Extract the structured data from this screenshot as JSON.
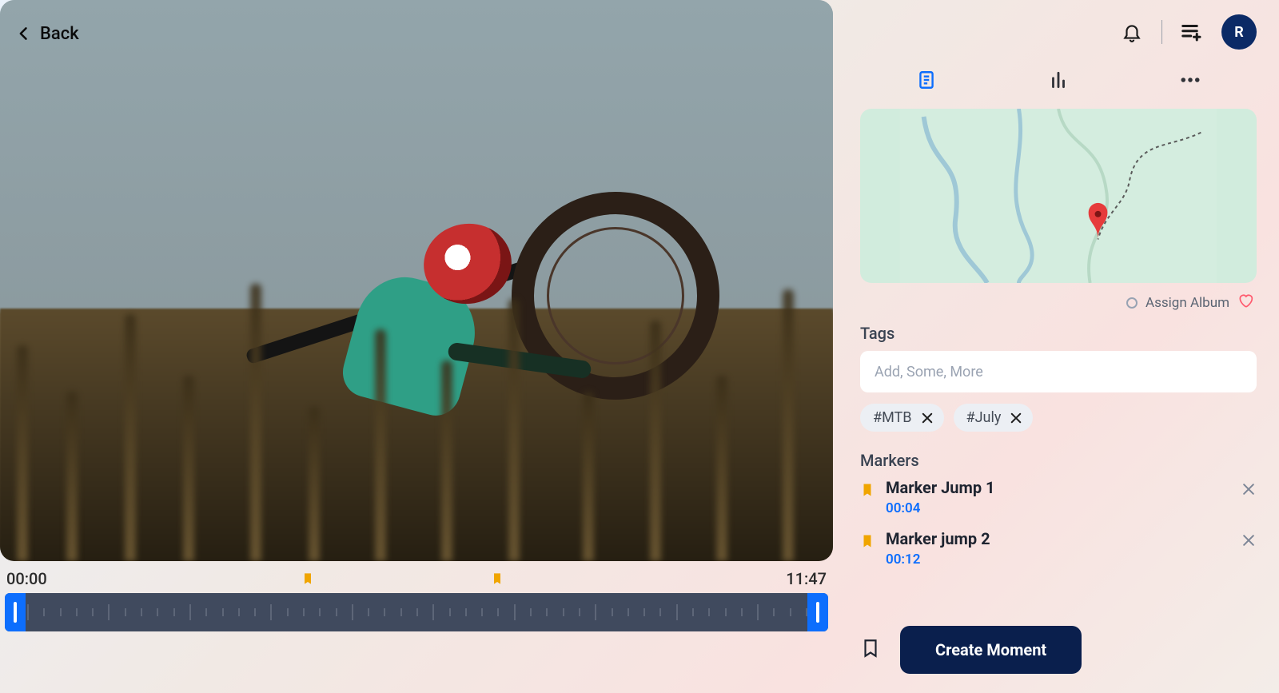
{
  "header": {
    "back_label": "Back",
    "avatar_initial": "R"
  },
  "timeline": {
    "start": "00:00",
    "end": "11:47",
    "flag_positions_pct": [
      36,
      59
    ]
  },
  "sidebar": {
    "assign_album_label": "Assign Album",
    "tags_label": "Tags",
    "tags_placeholder": "Add, Some, More",
    "tags": [
      "#MTB",
      "#July"
    ],
    "markers_label": "Markers",
    "markers": [
      {
        "title": "Marker Jump 1",
        "time": "00:04"
      },
      {
        "title": "Marker jump 2",
        "time": "00:12"
      }
    ],
    "create_button": "Create Moment"
  }
}
